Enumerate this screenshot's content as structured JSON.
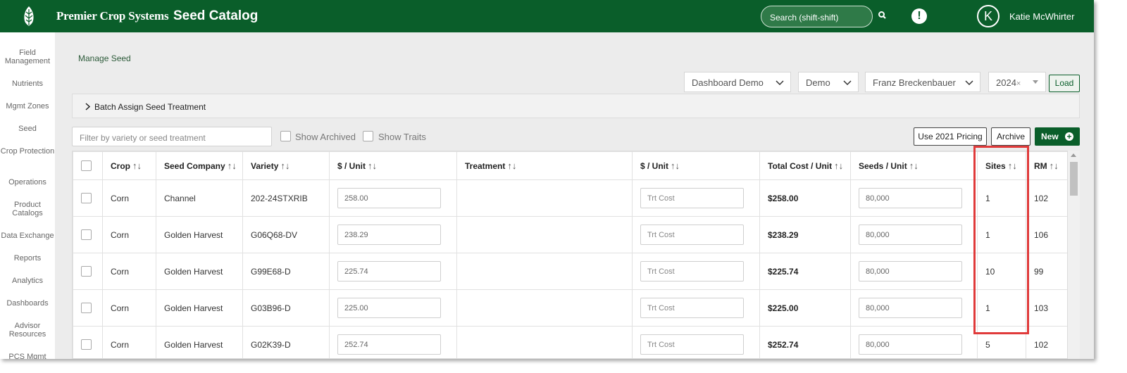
{
  "header": {
    "brand": "Premier Crop Systems",
    "app_title": "Seed Catalog",
    "search_placeholder": "Search (shift-shift)",
    "avatar_initial": "K",
    "user_name": "Katie McWhirter",
    "alert_glyph": "!",
    "bg_color": "#0a5e2a"
  },
  "sidebar": {
    "items": [
      {
        "label": "Field Management"
      },
      {
        "label": "Nutrients"
      },
      {
        "label": "Mgmt Zones"
      },
      {
        "label": "Seed"
      },
      {
        "label": "Crop Protection"
      },
      {
        "label": "Operations"
      },
      {
        "label": "Product Catalogs"
      },
      {
        "label": "Data Exchange"
      },
      {
        "label": "Reports"
      },
      {
        "label": "Analytics"
      },
      {
        "label": "Dashboards"
      },
      {
        "label": "Advisor Resources"
      },
      {
        "label": "PCS Mgmt"
      }
    ]
  },
  "breadcrumb": "Manage Seed",
  "selectors": {
    "dashboard": "Dashboard Demo",
    "demo": "Demo",
    "person": "Franz Breckenbauer",
    "year": "2024",
    "year_clear": "×",
    "load_label": "Load"
  },
  "batch": {
    "label": "Batch Assign Seed Treatment"
  },
  "filters": {
    "placeholder": "Filter by variety or seed treatment",
    "show_archived": "Show Archived",
    "show_traits": "Show Traits"
  },
  "actions": {
    "pricing_label": "Use 2021 Pricing",
    "archive_label": "Archive",
    "new_label": "New",
    "new_icon_glyph": "+"
  },
  "table": {
    "sort_glyph": "↑↓",
    "columns": [
      "Crop",
      "Seed Company",
      "Variety",
      "$ / Unit",
      "Treatment",
      "$ / Unit",
      "Total Cost / Unit",
      "Seeds / Unit",
      "Sites",
      "RM"
    ],
    "trt_placeholder": "Trt Cost",
    "rows": [
      {
        "crop": "Corn",
        "company": "Channel",
        "variety": "202-24STXRIB",
        "price": "258.00",
        "treatment": "",
        "total": "$258.00",
        "seeds": "80,000",
        "sites": "1",
        "rm": "102"
      },
      {
        "crop": "Corn",
        "company": "Golden Harvest",
        "variety": "G06Q68-DV",
        "price": "238.29",
        "treatment": "",
        "total": "$238.29",
        "seeds": "80,000",
        "sites": "1",
        "rm": "106"
      },
      {
        "crop": "Corn",
        "company": "Golden Harvest",
        "variety": "G99E68-D",
        "price": "225.74",
        "treatment": "",
        "total": "$225.74",
        "seeds": "80,000",
        "sites": "10",
        "rm": "99"
      },
      {
        "crop": "Corn",
        "company": "Golden Harvest",
        "variety": "G03B96-D",
        "price": "225.00",
        "treatment": "",
        "total": "$225.00",
        "seeds": "80,000",
        "sites": "1",
        "rm": "103"
      },
      {
        "crop": "Corn",
        "company": "Golden Harvest",
        "variety": "G02K39-D",
        "price": "252.74",
        "treatment": "",
        "total": "$252.74",
        "seeds": "80,000",
        "sites": "5",
        "rm": "102"
      }
    ]
  },
  "highlight_color": "#e03a3a"
}
